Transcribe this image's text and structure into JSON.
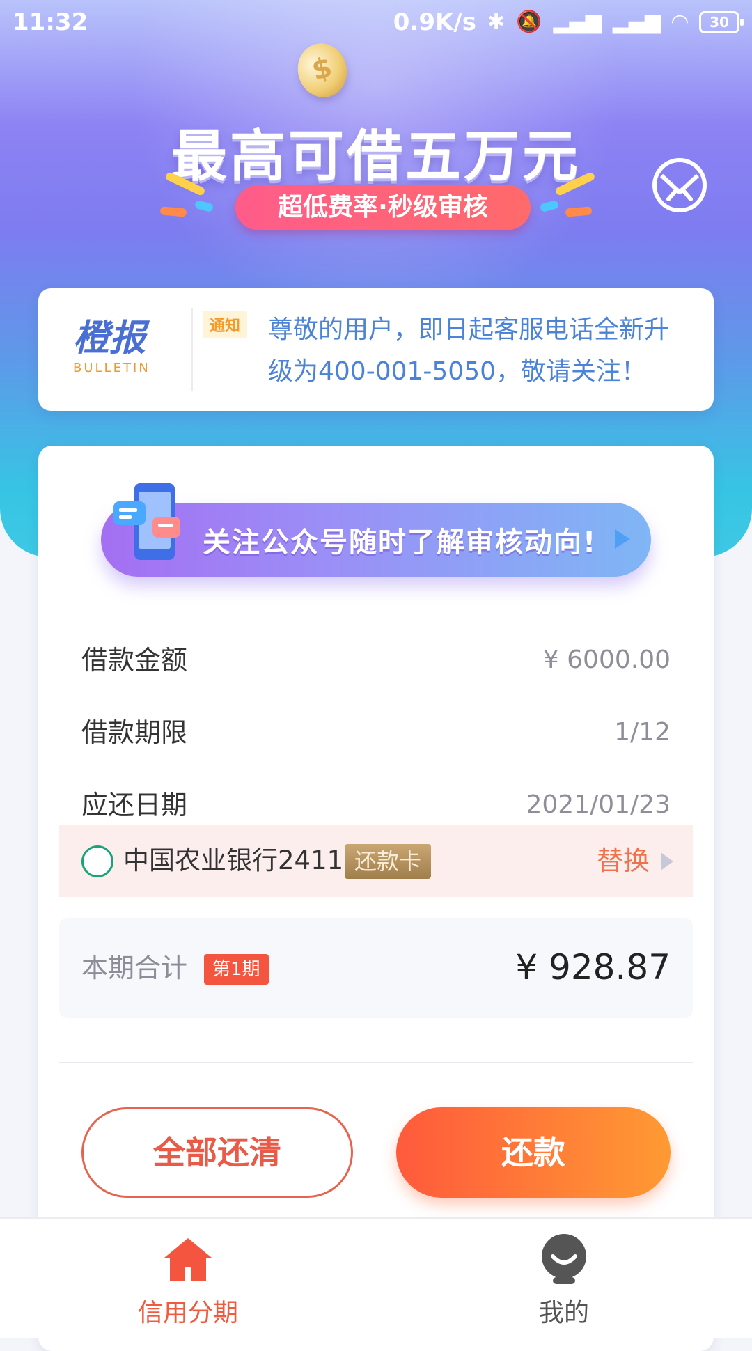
{
  "status_bar": {
    "time": "11:32",
    "speed": "0.9K/s",
    "battery": "30"
  },
  "hero": {
    "headline": "最高可借五万元",
    "pill": "超低费率·秒级审核"
  },
  "bulletin": {
    "logo_cn": "橙报",
    "logo_en": "BULLETIN",
    "tag": "通知",
    "text": "尊敬的用户，即日起客服电话全新升级为400-001-5050，敬请关注！"
  },
  "card": {
    "follow_banner": "关注公众号随时了解审核动向!",
    "rows": [
      {
        "label": "借款金额",
        "value": "¥ 6000.00"
      },
      {
        "label": "借款期限",
        "value": "1/12"
      },
      {
        "label": "应还日期",
        "value": "2021/01/23"
      }
    ],
    "bank": {
      "name": "中国农业银行2411",
      "badge": "还款卡",
      "switch_label": "替换"
    },
    "total": {
      "label": "本期合计",
      "period_badge": "第1期",
      "amount": "¥ 928.87"
    },
    "buttons": {
      "pay_all": "全部还清",
      "repay": "还款"
    }
  },
  "tabbar": {
    "items": [
      {
        "label": "信用分期",
        "icon": "home-icon",
        "active": true
      },
      {
        "label": "我的",
        "icon": "profile-icon",
        "active": false
      }
    ]
  },
  "colors": {
    "accent": "#f05a3e",
    "primary_gradient_start": "#ff5a3c",
    "primary_gradient_end": "#ff9a33",
    "bulletin_text": "#4b83d8"
  }
}
